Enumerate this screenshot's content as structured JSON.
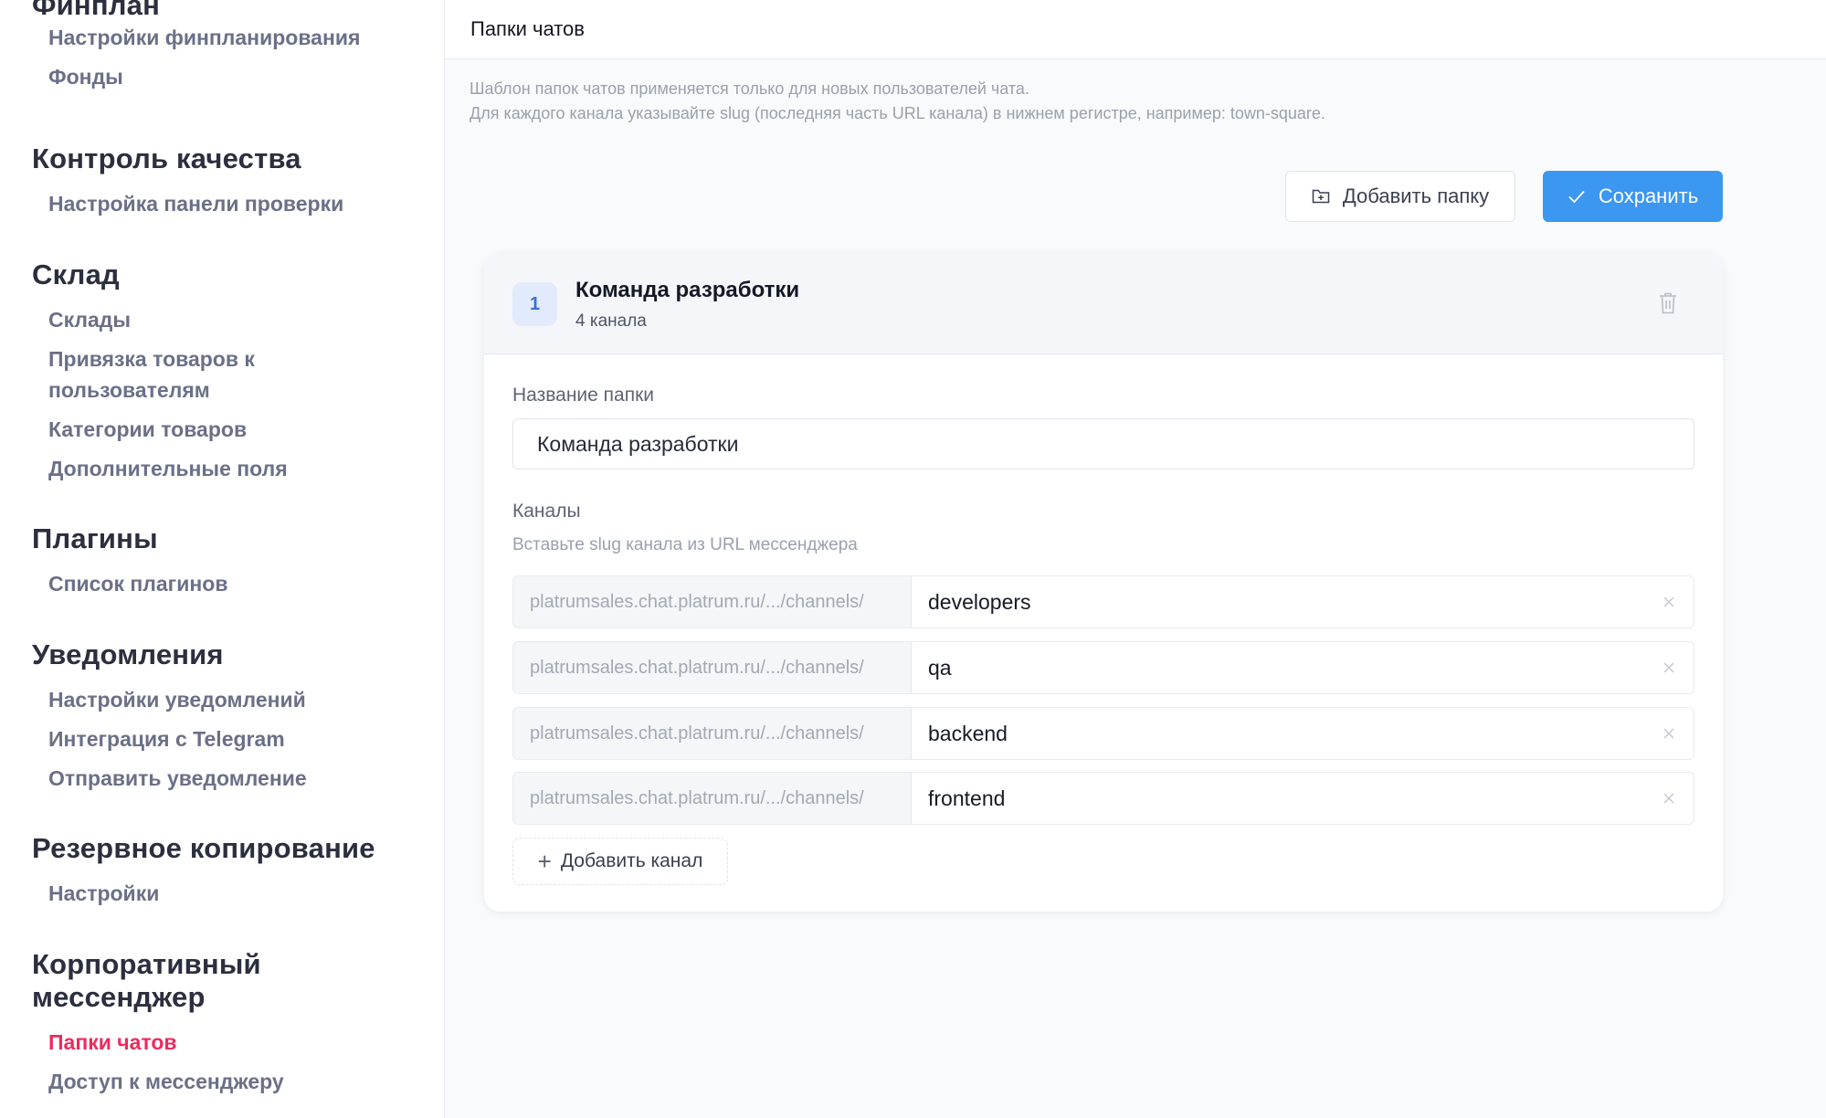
{
  "sidebar": {
    "sections": [
      {
        "title": "Финплан",
        "items": [
          {
            "label": "Настройки финпланирования"
          },
          {
            "label": "Фонды"
          }
        ]
      },
      {
        "title": "Контроль качества",
        "items": [
          {
            "label": "Настройка панели проверки"
          }
        ]
      },
      {
        "title": "Склад",
        "items": [
          {
            "label": "Склады"
          },
          {
            "label": "Привязка товаров к пользователям"
          },
          {
            "label": "Категории товаров"
          },
          {
            "label": "Дополнительные поля"
          }
        ]
      },
      {
        "title": "Плагины",
        "items": [
          {
            "label": "Список плагинов"
          }
        ]
      },
      {
        "title": "Уведомления",
        "items": [
          {
            "label": "Настройки уведомлений"
          },
          {
            "label": "Интеграция с Telegram"
          },
          {
            "label": "Отправить уведомление"
          }
        ]
      },
      {
        "title": "Резервное копирование",
        "items": [
          {
            "label": "Настройки"
          }
        ]
      },
      {
        "title": "Корпоративный мессенджер",
        "items": [
          {
            "label": "Папки чатов",
            "active": true
          },
          {
            "label": "Доступ к мессенджеру"
          }
        ]
      }
    ]
  },
  "header": {
    "title": "Папки чатов"
  },
  "hint": {
    "line1": "Шаблон папок чатов применяется только для новых пользователей чата.",
    "line2": "Для каждого канала указывайте slug (последняя часть URL канала) в нижнем регистре, например: town-square."
  },
  "toolbar": {
    "add_folder_label": "Добавить папку",
    "save_label": "Сохранить"
  },
  "colors": {
    "accent": "#3b97f0",
    "active_nav": "#ec2b5d"
  },
  "folder": {
    "number": "1",
    "title": "Команда разработки",
    "subtitle": "4 канала",
    "name_label": "Название папки",
    "name_value": "Команда разработки",
    "channels_label": "Каналы",
    "channels_helper": "Вставьте slug канала из URL мессенджера",
    "channel_prefix": "platrumsales.chat.platrum.ru/.../channels/",
    "channels": [
      "developers",
      "qa",
      "backend",
      "frontend"
    ],
    "add_channel_label": "Добавить канал"
  }
}
